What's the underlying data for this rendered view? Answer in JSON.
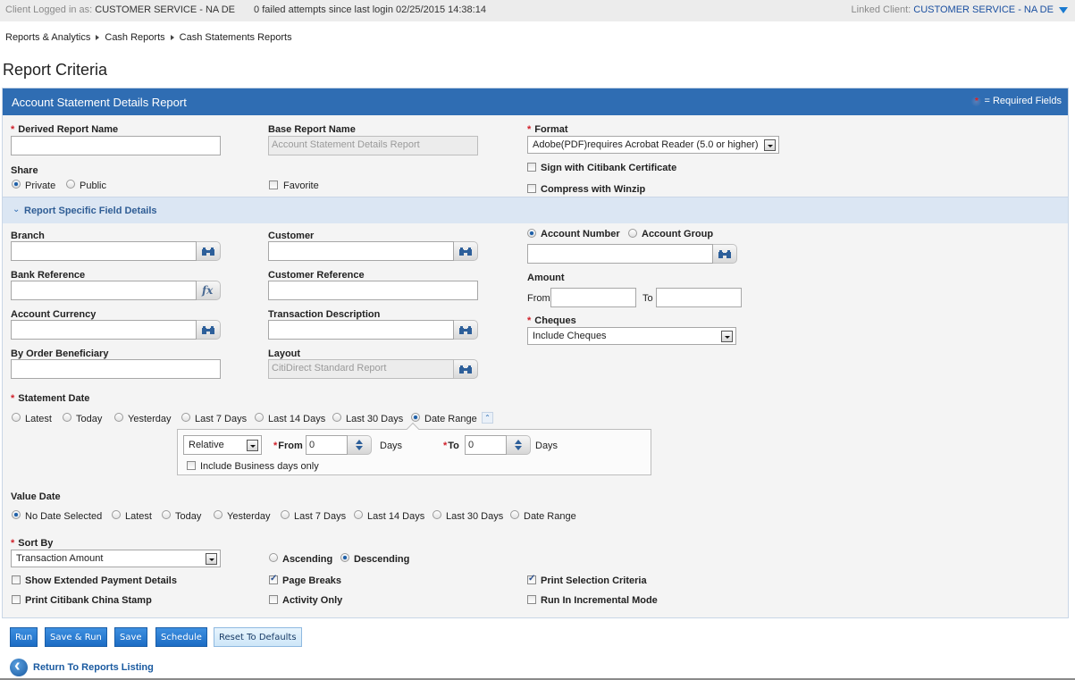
{
  "topbar": {
    "logged_label": "Client Logged in as:",
    "logged_value": "CUSTOMER SERVICE - NA DE",
    "failed_attempts": "0 failed attempts since last login 02/25/2015 14:38:14",
    "linked_label": "Linked Client:",
    "linked_value": "CUSTOMER SERVICE - NA DE"
  },
  "breadcrumb": [
    "Reports & Analytics",
    "Cash Reports",
    "Cash Statements Reports"
  ],
  "page_title": "Report Criteria",
  "panel": {
    "title": "Account Statement Details Report",
    "required_legend": "= Required Fields",
    "required_star": "*"
  },
  "general": {
    "derived_report_name": {
      "label": "Derived Report Name",
      "value": ""
    },
    "base_report_name": {
      "label": "Base Report Name",
      "value": "Account Statement Details Report"
    },
    "format": {
      "label": "Format",
      "selected": "Adobe(PDF)requires Acrobat Reader (5.0 or higher)"
    },
    "share": {
      "label": "Share",
      "options": [
        {
          "label": "Private",
          "checked": true
        },
        {
          "label": "Public",
          "checked": false
        }
      ]
    },
    "favorite": {
      "label": "Favorite",
      "checked": false
    },
    "sign_cert": {
      "label": "Sign with Citibank Certificate",
      "checked": false
    },
    "compress": {
      "label": "Compress with Winzip",
      "checked": false
    }
  },
  "section": {
    "title": "Report Specific Field Details",
    "branch": {
      "label": "Branch",
      "value": ""
    },
    "bank_reference": {
      "label": "Bank Reference",
      "value": ""
    },
    "account_currency": {
      "label": "Account Currency",
      "value": ""
    },
    "by_order_beneficiary": {
      "label": "By Order Beneficiary",
      "value": ""
    },
    "customer": {
      "label": "Customer",
      "value": ""
    },
    "customer_reference": {
      "label": "Customer Reference",
      "value": ""
    },
    "transaction_description": {
      "label": "Transaction Description",
      "value": ""
    },
    "layout": {
      "label": "Layout",
      "value": "CitiDirect Standard Report"
    },
    "account_type": {
      "options": [
        {
          "label": "Account Number",
          "checked": true
        },
        {
          "label": "Account Group",
          "checked": false
        }
      ],
      "value": ""
    },
    "amount": {
      "label": "Amount",
      "from_label": "From",
      "to_label": "To",
      "from": "",
      "to": ""
    },
    "cheques": {
      "label": "Cheques",
      "selected": "Include Cheques"
    }
  },
  "statement_date": {
    "label": "Statement Date",
    "options": [
      {
        "label": "Latest",
        "checked": false
      },
      {
        "label": "Today",
        "checked": false
      },
      {
        "label": "Yesterday",
        "checked": false
      },
      {
        "label": "Last 7 Days",
        "checked": false
      },
      {
        "label": "Last 14 Days",
        "checked": false
      },
      {
        "label": "Last 30 Days",
        "checked": false
      },
      {
        "label": "Date Range",
        "checked": true
      }
    ],
    "range": {
      "mode": "Relative",
      "from_label": "From",
      "from_value": "0",
      "to_label": "To",
      "to_value": "0",
      "unit": "Days",
      "business_days": {
        "label": "Include Business days only",
        "checked": false
      }
    }
  },
  "value_date": {
    "label": "Value Date",
    "options": [
      {
        "label": "No Date Selected",
        "checked": true
      },
      {
        "label": "Latest",
        "checked": false
      },
      {
        "label": "Today",
        "checked": false
      },
      {
        "label": "Yesterday",
        "checked": false
      },
      {
        "label": "Last 7 Days",
        "checked": false
      },
      {
        "label": "Last 14 Days",
        "checked": false
      },
      {
        "label": "Last 30 Days",
        "checked": false
      },
      {
        "label": "Date Range",
        "checked": false
      }
    ]
  },
  "sort": {
    "label": "Sort By",
    "selected": "Transaction Amount",
    "order": [
      {
        "label": "Ascending",
        "checked": false
      },
      {
        "label": "Descending",
        "checked": true
      }
    ]
  },
  "options": {
    "show_extended": {
      "label": "Show Extended Payment Details",
      "checked": false
    },
    "page_breaks": {
      "label": "Page Breaks",
      "checked": true
    },
    "print_selection": {
      "label": "Print Selection Criteria",
      "checked": true
    },
    "china_stamp": {
      "label": "Print Citibank China Stamp",
      "checked": false
    },
    "activity_only": {
      "label": "Activity Only",
      "checked": false
    },
    "incremental": {
      "label": "Run In Incremental Mode",
      "checked": false
    }
  },
  "buttons": {
    "run": "Run",
    "save_run": "Save & Run",
    "save": "Save",
    "schedule": "Schedule",
    "reset": "Reset To Defaults"
  },
  "return_link": "Return To Reports Listing",
  "colors": {
    "header_blue": "#2f6db3",
    "section_bar": "#dbe6f3",
    "required_red": "#d0202a",
    "button_blue": "#1c6cc4"
  }
}
